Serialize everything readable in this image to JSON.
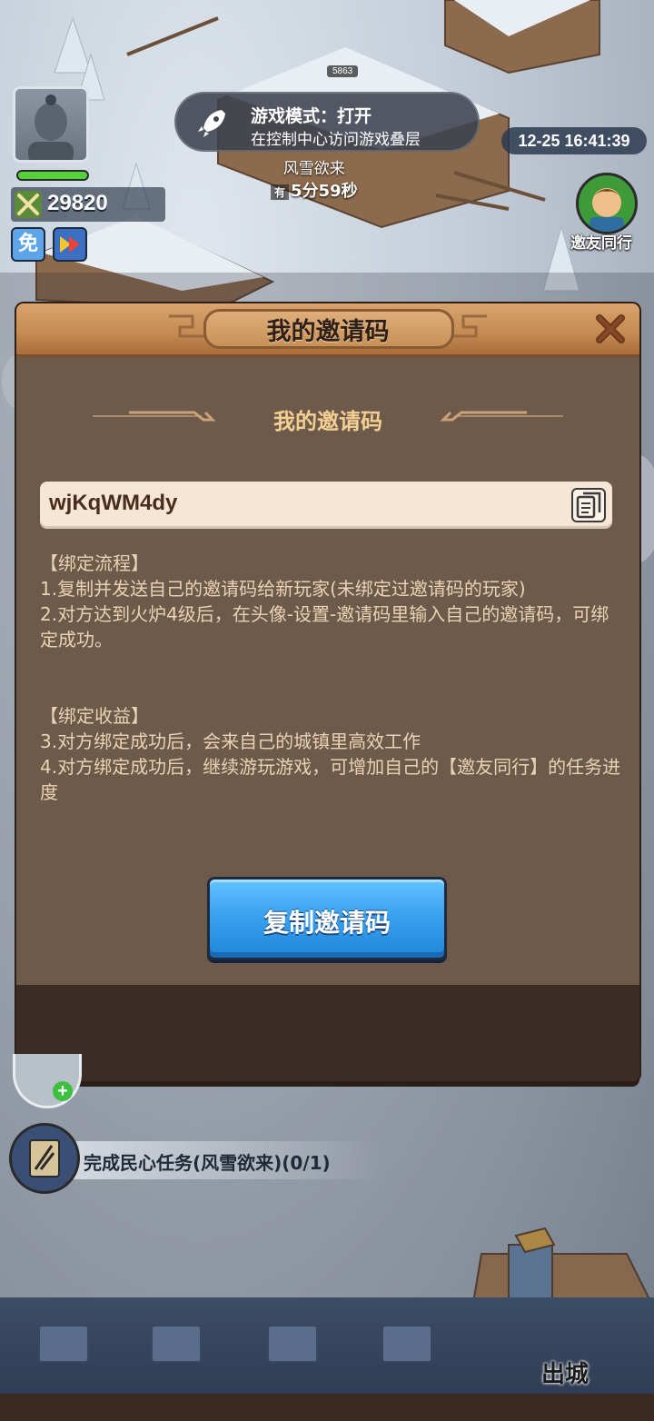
{
  "hud": {
    "power_value": "29820",
    "badge_char": "免",
    "toast_title": "游戏模式：打开",
    "toast_sub": "在控制中心访问游戏叠层",
    "player_level": "5863",
    "storm_name": "风雪欲来",
    "storm_prefix": "有",
    "storm_time": "5分59秒",
    "clock": "12-25 16:41:39",
    "invite_label": "邀友同行",
    "hp_fraction": 1.0
  },
  "dialog": {
    "title": "我的邀请码",
    "subtitle": "我的邀请码",
    "code": "wjKqWM4dy",
    "lines": [
      "【绑定流程】",
      "1.复制并发送自己的邀请码给新玩家(未绑定过邀请码的玩家)",
      "2.对方达到火炉4级后，在头像-设置-邀请码里输入自己的邀请码，可绑定成功。"
    ],
    "lines2": [
      "【绑定收益】",
      "3.对方绑定成功后，会来自己的城镇里高效工作",
      "4.对方绑定成功后，继续游玩游戏，可增加自己的【邀友同行】的任务进度"
    ],
    "copy_button": "复制邀请码"
  },
  "bottom": {
    "task_label": "完成民心任务(风雪欲来)(0/1)",
    "exit_label": "出城"
  },
  "colors": {
    "dialog_bg": "#6e5a4b",
    "header": "#c48a52",
    "button": "#3aa2f1",
    "subtitle": "#f3cf94"
  }
}
